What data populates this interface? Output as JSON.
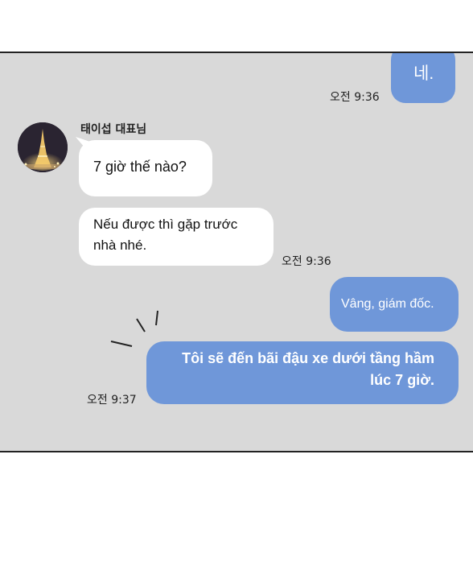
{
  "messages": {
    "top_reply": {
      "text": "네.",
      "time": "오전 9:36"
    },
    "sender_name": "태이섭 대표님",
    "incoming_1": {
      "text": "7 giờ thế nào?"
    },
    "incoming_2": {
      "text": "Nếu được thì gặp trước nhà nhé.",
      "time": "오전 9:36"
    },
    "outgoing_1": {
      "text": "Vâng, giám đốc."
    },
    "outgoing_2": {
      "text": "Tôi sẽ đến bãi đậu xe dưới tầng hầm lúc 7 giờ.",
      "time": "오전 9:37"
    }
  },
  "colors": {
    "panel_bg": "#d9d9d9",
    "outgoing_bubble": "#6f97d9",
    "incoming_bubble": "#ffffff"
  },
  "icons": [
    "eiffel-tower-avatar-icon",
    "emphasis-strokes-icon"
  ]
}
